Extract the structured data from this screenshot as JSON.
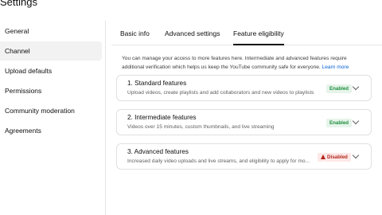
{
  "header": {
    "title": "Settings"
  },
  "sidebar": {
    "items": [
      {
        "label": "General"
      },
      {
        "label": "Channel"
      },
      {
        "label": "Upload defaults"
      },
      {
        "label": "Permissions"
      },
      {
        "label": "Community moderation"
      },
      {
        "label": "Agreements"
      }
    ]
  },
  "tabs": [
    {
      "label": "Basic info"
    },
    {
      "label": "Advanced settings"
    },
    {
      "label": "Feature eligibility"
    }
  ],
  "main": {
    "intro": "You can manage your access to more features here. Intermediate and advanced features require additional verification which helps us keep the YouTube community safe for everyone.",
    "learn_more": "Learn more",
    "cards": [
      {
        "title": "1. Standard features",
        "description": "Upload videos, create playlists and add collaborators and new videos to playlists",
        "status": "Enabled"
      },
      {
        "title": "2. Intermediate features",
        "description": "Videos over 15 minutes, custom thumbnails, and live streaming",
        "status": "Enabled"
      },
      {
        "title": "3. Advanced features",
        "description": "Increased daily video uploads and live streams, and eligibility to apply for mo...",
        "status": "Disabled"
      }
    ]
  },
  "colors": {
    "enabled_bg": "#e6f4ea",
    "enabled_text": "#1e8e3e",
    "disabled_bg": "#fce8e6",
    "disabled_text": "#b3261e",
    "link": "#065fd4"
  },
  "icons": {
    "card_chevron": "chevron-down-icon",
    "disabled_badge": "warning-icon"
  }
}
